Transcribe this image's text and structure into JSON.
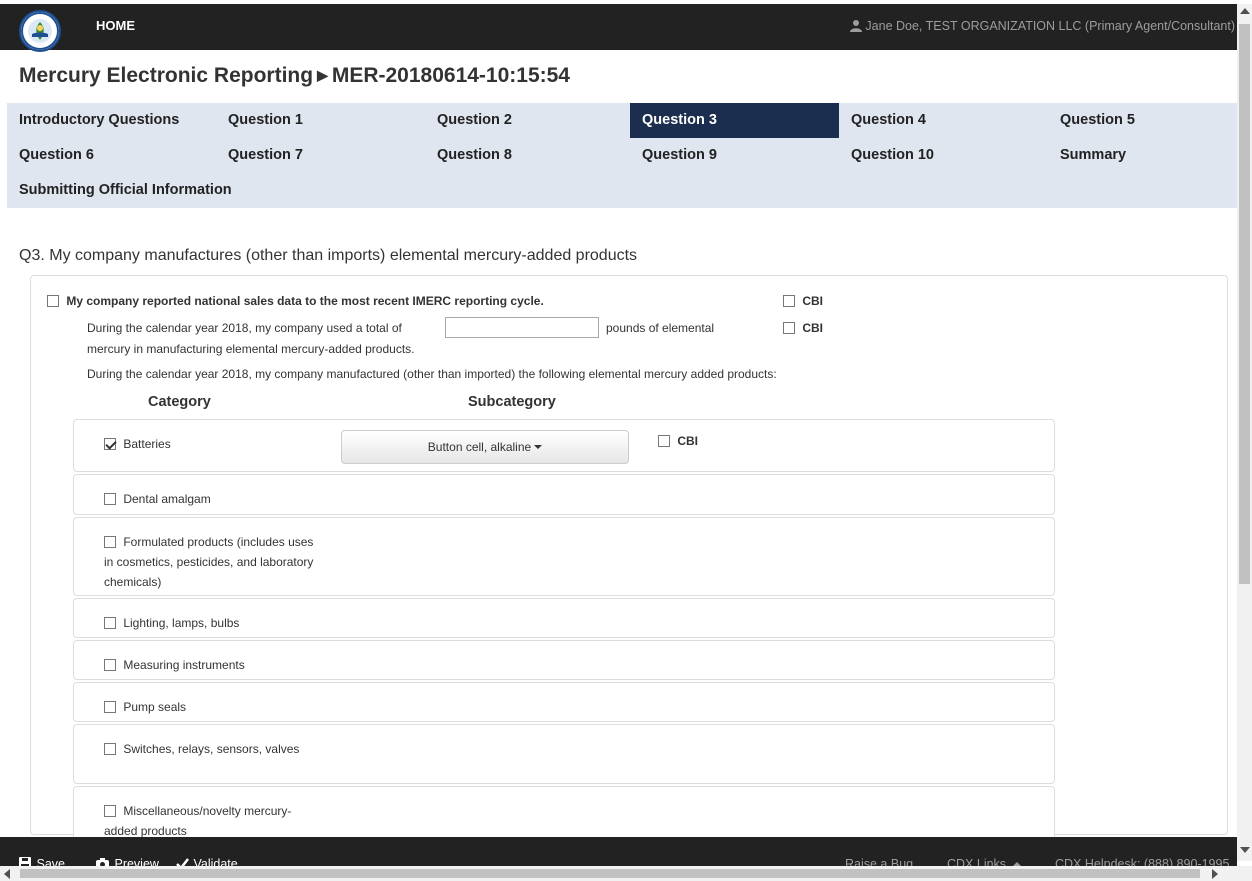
{
  "header": {
    "home_label": "HOME",
    "user_label": "Jane Doe, TEST ORGANIZATION LLC (Primary Agent/Consultant)",
    "logo_icon": "epa-seal-icon",
    "user_icon": "user-icon"
  },
  "page": {
    "title_main": "Mercury Electronic Reporting",
    "title_arrow": "▶",
    "title_id": "MER-20180614-10:15:54"
  },
  "nav": {
    "active": "Question 3",
    "items": [
      {
        "label": "Introductory Questions"
      },
      {
        "label": "Question 1"
      },
      {
        "label": "Question 2"
      },
      {
        "label": "Question 3"
      },
      {
        "label": "Question 4"
      },
      {
        "label": "Question 5"
      },
      {
        "label": "Question 6"
      },
      {
        "label": "Question 7"
      },
      {
        "label": "Question 8"
      },
      {
        "label": "Question 9"
      },
      {
        "label": "Question 10"
      },
      {
        "label": "Summary"
      },
      {
        "label": "Submitting Official Information"
      }
    ]
  },
  "question": {
    "text": "Q3. My company manufactures (other than imports) elemental mercury-added products",
    "national_sales_label": "My company reported national sales data to the most recent IMERC reporting cycle.",
    "national_sales_checked": false,
    "cbi_label": "CBI",
    "used_text_before": "During the calendar year 2018, my company used a total of",
    "used_value": "",
    "used_text_after": "pounds of elemental",
    "used_text_line2": "mercury in manufacturing elemental mercury-added products.",
    "manufactured_text": "During the calendar year 2018, my company manufactured (other than imported) the following elemental mercury added products:",
    "category_header": "Category",
    "subcategory_header": "Subcategory"
  },
  "categories": [
    {
      "label": "Batteries",
      "checked": true,
      "subcategory": "Button cell, alkaline",
      "cbi": "CBI"
    },
    {
      "label": "Dental amalgam",
      "checked": false
    },
    {
      "label": "Formulated products (includes uses in cosmetics, pesticides, and laboratory chemicals)",
      "checked": false
    },
    {
      "label": "Lighting, lamps, bulbs",
      "checked": false
    },
    {
      "label": "Measuring instruments",
      "checked": false
    },
    {
      "label": "Pump seals",
      "checked": false
    },
    {
      "label": "Switches, relays, sensors, valves",
      "checked": false
    },
    {
      "label": "Miscellaneous/novelty mercury-added products",
      "checked": false
    }
  ],
  "footer": {
    "save_label": "Save",
    "preview_label": "Preview",
    "validate_label": "Validate",
    "raise_bug_label": "Raise a Bug",
    "cdx_links_label": "CDX Links",
    "helpdesk_label": "CDX Helpdesk: (888) 890-1995"
  },
  "colors": {
    "topbar": "#222222",
    "nav_bg": "#dfe6ef",
    "nav_active": "#1b2e4f"
  }
}
